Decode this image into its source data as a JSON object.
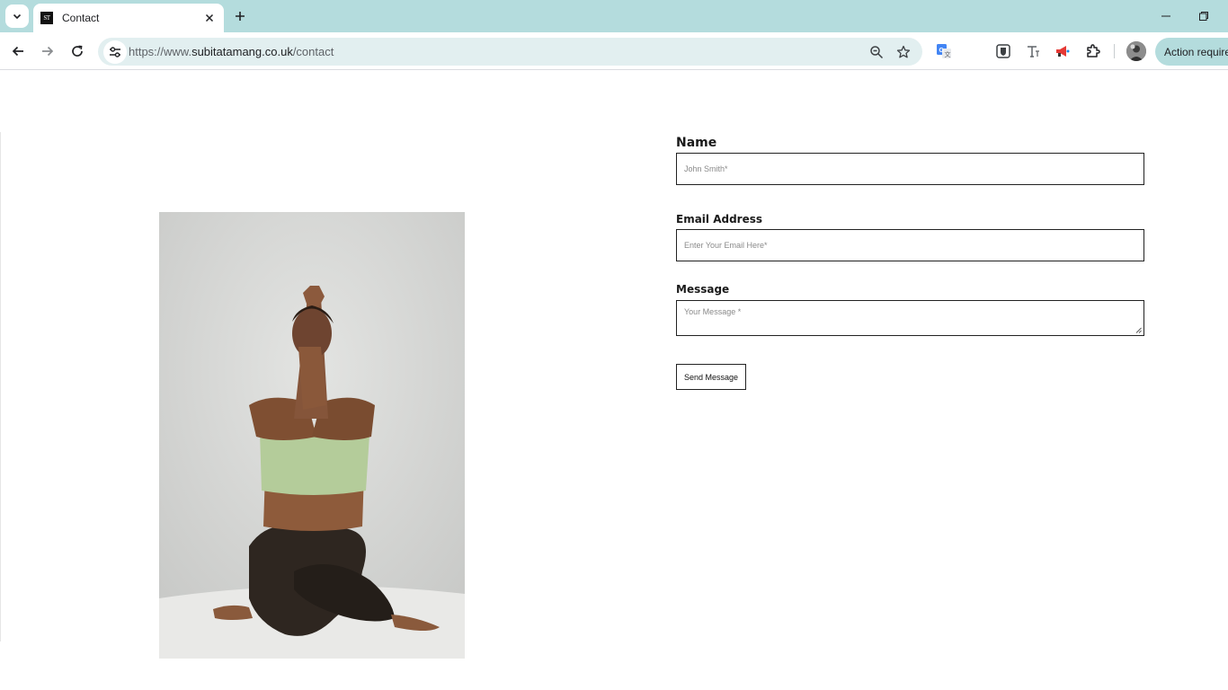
{
  "browser": {
    "tab_title": "Contact",
    "favicon_text": "ST",
    "url_prefix": "https://www.",
    "url_host": "subitatamang.co.uk",
    "url_path": "/contact",
    "action_button_label": "Action required",
    "accent_color": "#b4dcdd"
  },
  "form": {
    "name_label": "Name",
    "name_placeholder": "John Smith*",
    "email_label": "Email Address",
    "email_placeholder": "Enter Your Email Here*",
    "message_label": "Message",
    "message_placeholder": "Your Message *",
    "submit_label": "Send Message"
  },
  "photo": {
    "alt": "woman seated in yoga pose"
  }
}
